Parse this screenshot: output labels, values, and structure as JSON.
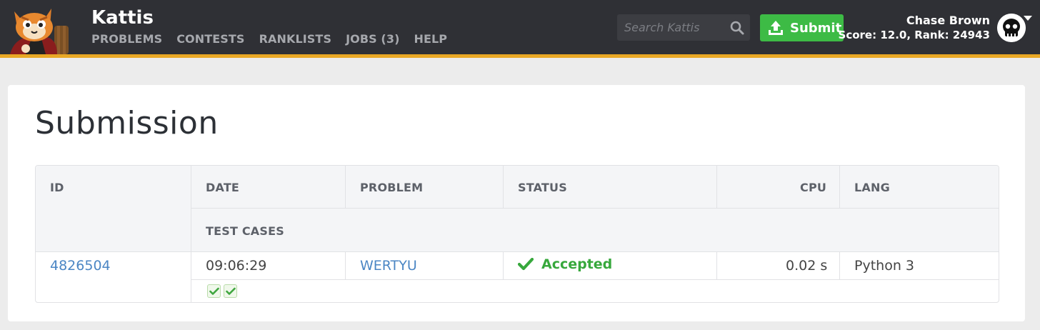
{
  "header": {
    "brand": "Kattis",
    "nav": [
      "PROBLEMS",
      "CONTESTS",
      "RANKLISTS",
      "JOBS (3)",
      "HELP"
    ],
    "search": {
      "placeholder": "Search Kattis",
      "value": ""
    },
    "submit_label": "Submit",
    "user": {
      "name": "Chase Brown",
      "score_line": "Score: 12.0, Rank: 24943"
    },
    "colors": {
      "bar": "#2f3035",
      "accent": "#e9a825",
      "submit": "#3dbb45"
    }
  },
  "main": {
    "title": "Submission",
    "table": {
      "columns": {
        "id": "ID",
        "date": "DATE",
        "problem": "PROBLEM",
        "status": "STATUS",
        "cpu": "CPU",
        "lang": "LANG",
        "test_cases": "TEST CASES"
      },
      "row": {
        "id": "4826504",
        "date": "09:06:29",
        "problem": "WERTYU",
        "status": "Accepted",
        "status_icon": "check-icon",
        "cpu": "0.02 s",
        "lang": "Python 3",
        "test_cases_passed": 2
      }
    }
  }
}
